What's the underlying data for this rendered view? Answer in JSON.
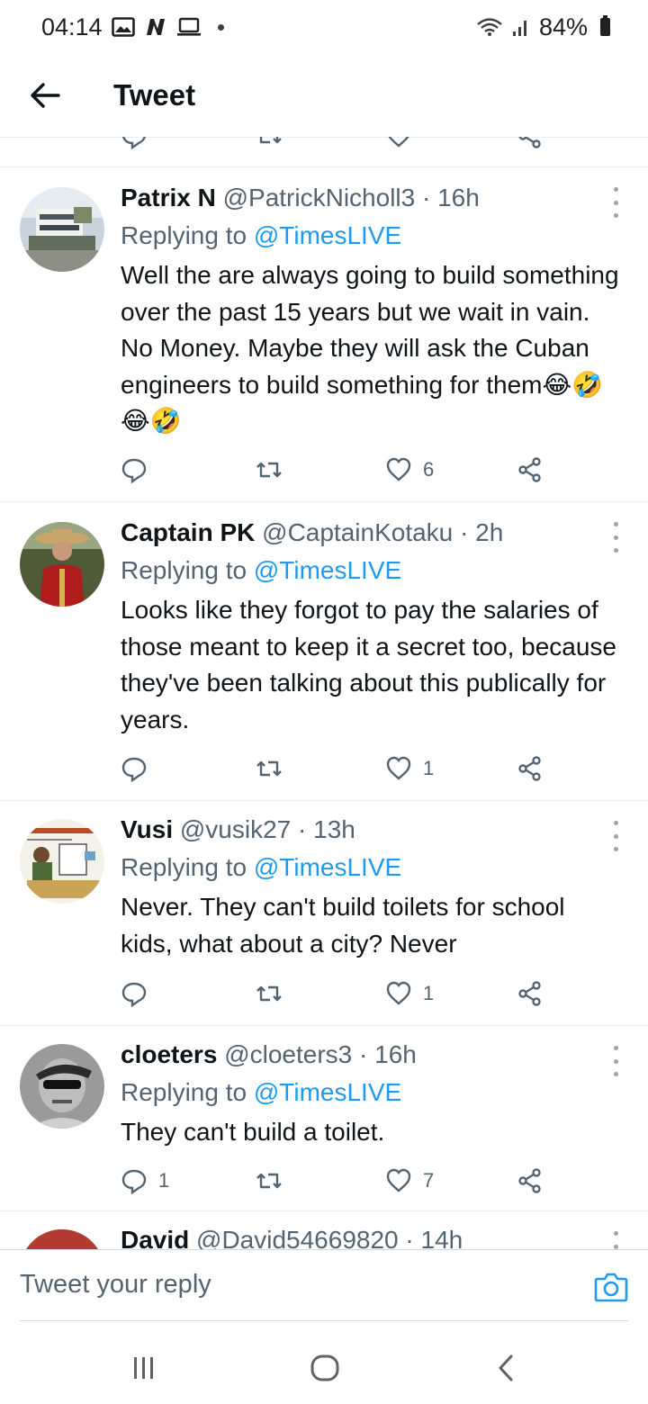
{
  "status_bar": {
    "time": "04:14",
    "battery": "84%",
    "icons": [
      "gallery-icon",
      "n-icon",
      "laptop-icon",
      "wifi-icon",
      "signal-icon",
      "battery-icon"
    ]
  },
  "header": {
    "title": "Tweet",
    "back_icon": "arrow-left-icon"
  },
  "tweets": [
    {
      "name": "Patrix N",
      "handle": "@PatrickNicholl3",
      "sep": "·",
      "time": "16h",
      "replying_prefix": "Replying to ",
      "replying_to": "@TimesLIVE",
      "text": "Well the are always going to build something over the past 15 years but we wait in vain. No Money. Maybe they will ask the Cuban engineers to build something for them😂🤣😂🤣",
      "reply_count": "",
      "retweet_count": "",
      "like_count": "6"
    },
    {
      "name": "Captain PK",
      "handle": "@CaptainKotaku",
      "sep": "·",
      "time": "2h",
      "replying_prefix": "Replying to ",
      "replying_to": "@TimesLIVE",
      "text": "Looks like they forgot to pay the salaries of those meant to keep it a secret too, because they've been talking about this publically for years.",
      "reply_count": "",
      "retweet_count": "",
      "like_count": "1"
    },
    {
      "name": "Vusi",
      "handle": "@vusik27",
      "sep": "·",
      "time": "13h",
      "replying_prefix": "Replying to ",
      "replying_to": "@TimesLIVE",
      "text": "Never. They can't build toilets for school kids, what about a city? Never",
      "reply_count": "",
      "retweet_count": "",
      "like_count": "1"
    },
    {
      "name": "cloeters",
      "handle": "@cloeters3",
      "sep": "·",
      "time": "16h",
      "replying_prefix": "Replying to ",
      "replying_to": "@TimesLIVE",
      "text": "They can't build a toilet.",
      "reply_count": "1",
      "retweet_count": "",
      "like_count": "7"
    },
    {
      "name": "David",
      "handle": "@David54669820",
      "sep": "·",
      "time": "14h"
    }
  ],
  "reply_box": {
    "placeholder": "Tweet your reply",
    "camera_icon": "camera-icon"
  },
  "nav_bar": {
    "icons": [
      "recent-apps-icon",
      "home-icon",
      "back-icon"
    ]
  },
  "colors": {
    "accent": "#1d9bf0",
    "text_primary": "#0f1419",
    "text_secondary": "#536471",
    "divider": "#e6ecf0"
  }
}
